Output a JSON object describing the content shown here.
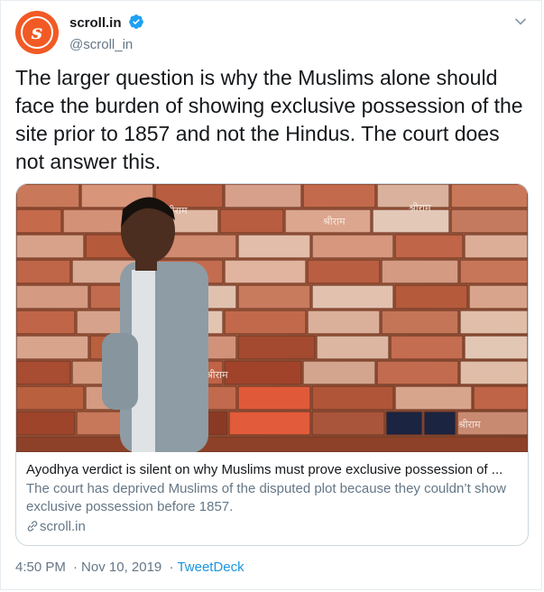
{
  "author": {
    "display_name": "scroll.in",
    "handle": "@scroll_in",
    "avatar_letter": "s",
    "avatar_color": "#f15a24",
    "verified_icon": "verified-badge-icon",
    "verified_color": "#1da1f2"
  },
  "tweet": {
    "text": "The larger question is why the Muslims alone should face the burden of showing exclusive possession of the site prior to 1857 and not the Hindus. The court does not answer this."
  },
  "card": {
    "image_alt": "Man walking past a wall of inscribed bricks",
    "image_inscriptions": [
      "श्रीराम",
      "श्रीराम",
      "श्रीराम",
      "श्रीराम",
      "श्रीराम"
    ],
    "title": "Ayodhya verdict is silent on why Muslims must prove exclusive possession of ...",
    "description": "The court has deprived Muslims of the disputed plot because they couldn’t show exclusive possession before 1857.",
    "domain": "scroll.in",
    "link_icon": "link-icon"
  },
  "meta": {
    "time": "4:50 PM",
    "date": "Nov 10, 2019",
    "separator1": "·",
    "separator2": "·",
    "source": "TweetDeck"
  },
  "colors": {
    "text": "#14171a",
    "secondary": "#657786",
    "link": "#1b95e0",
    "border": "#ccd6dd"
  }
}
